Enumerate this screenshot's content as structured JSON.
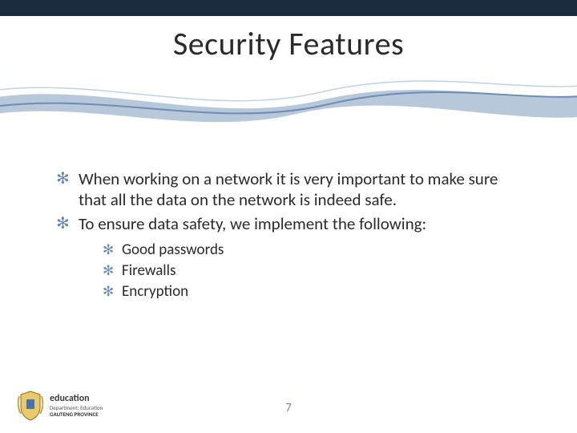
{
  "title": "Security Features",
  "bullets": [
    "When working on a network it is very important to make sure that all the data on the network is indeed safe.",
    "To ensure data safety, we implement the following:"
  ],
  "sub_bullets": [
    "Good passwords",
    "Firewalls",
    "Encryption"
  ],
  "page_number": "7",
  "logo": {
    "word": "education",
    "dept": "Department: Education",
    "prov": "GAUTENG PROVINCE"
  },
  "bullet_glyph": "✻",
  "colors": {
    "accent": "#6a8bb0",
    "band": "#1a2b3d"
  }
}
